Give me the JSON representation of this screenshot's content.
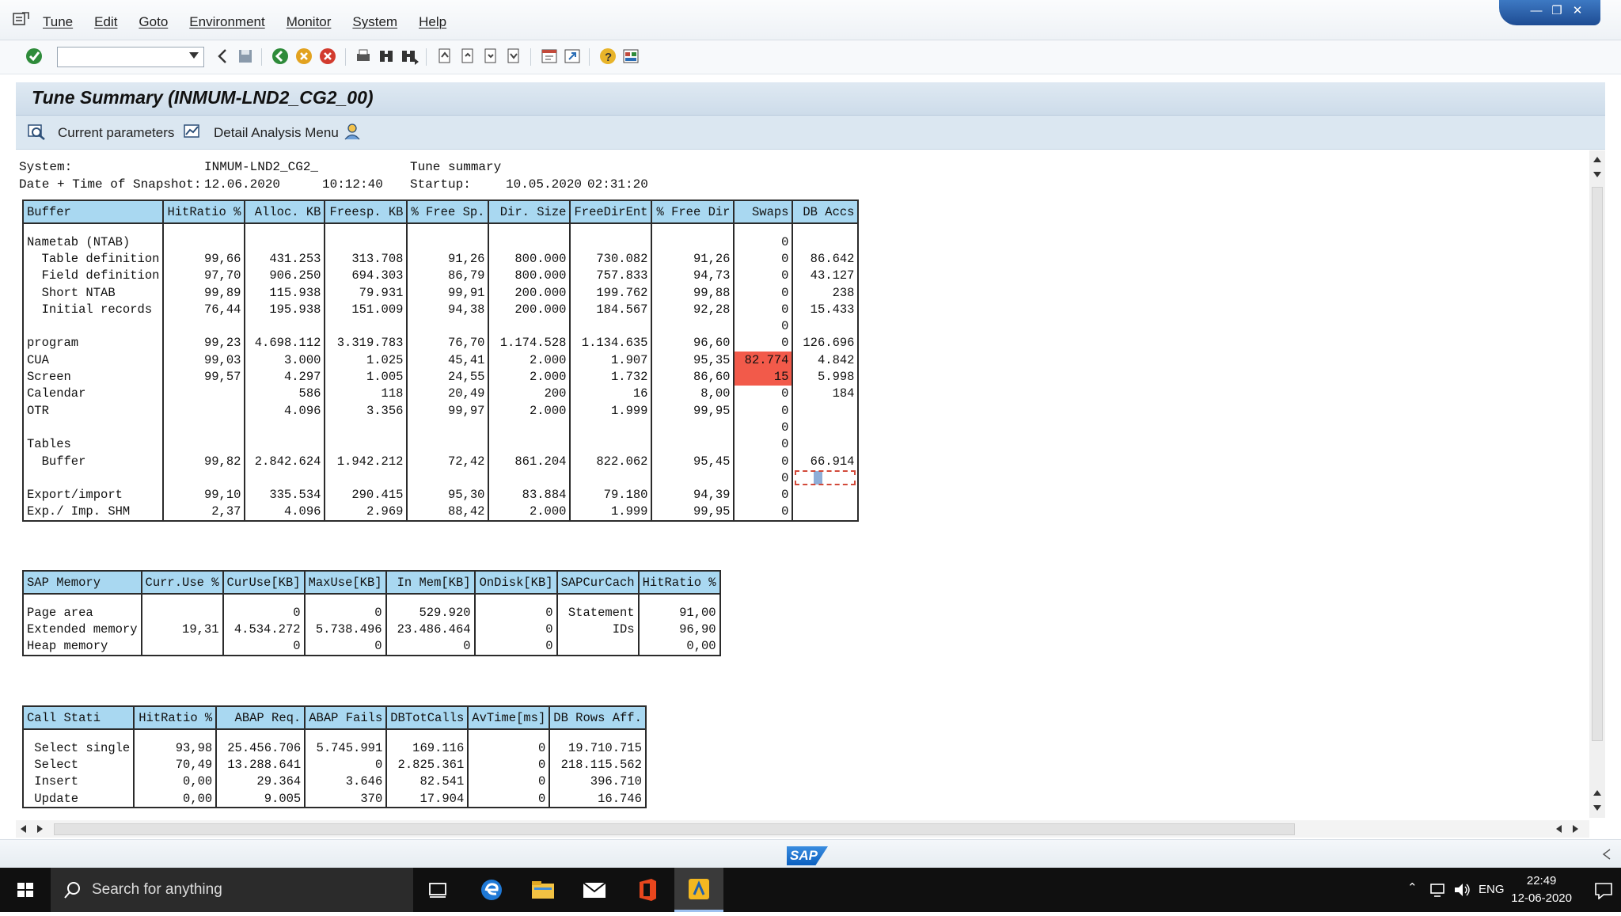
{
  "menu": [
    "Tune",
    "Edit",
    "Goto",
    "Environment",
    "Monitor",
    "System",
    "Help"
  ],
  "toolbar": {
    "command_value": ""
  },
  "page": {
    "title": "Tune Summary (INMUM-LND2_CG2_00)"
  },
  "app_toolbar": {
    "current_params": "Current parameters",
    "detail_menu": "Detail Analysis Menu"
  },
  "header": {
    "system_label": "System:",
    "system_value": "INMUM-LND2_CG2_",
    "summary_label": "Tune summary",
    "snapshot_label": "Date + Time of Snapshot:",
    "snapshot_date": "12.06.2020",
    "snapshot_time": "10:12:40",
    "startup_label": "Startup:",
    "startup_date": "10.05.2020",
    "startup_time": "02:31:20"
  },
  "buffer_table": {
    "columns": [
      "Buffer",
      "HitRatio %",
      "Alloc. KB",
      "Freesp. KB",
      "% Free Sp.",
      "Dir. Size",
      "FreeDirEnt",
      "% Free Dir",
      "Swaps",
      "DB Accs"
    ],
    "rows": [
      [
        "",
        "",
        "",
        "",
        "",
        "",
        "",
        "",
        "",
        ""
      ],
      [
        "Nametab (NTAB)",
        "",
        "",
        "",
        "",
        "",
        "",
        "",
        "0",
        ""
      ],
      [
        "  Table definition",
        "99,66",
        "431.253",
        "313.708",
        "91,26",
        "800.000",
        "730.082",
        "91,26",
        "0",
        "86.642"
      ],
      [
        "  Field definition",
        "97,70",
        "906.250",
        "694.303",
        "86,79",
        "800.000",
        "757.833",
        "94,73",
        "0",
        "43.127"
      ],
      [
        "  Short NTAB",
        "99,89",
        "115.938",
        "79.931",
        "99,91",
        "200.000",
        "199.762",
        "99,88",
        "0",
        "238"
      ],
      [
        "  Initial records",
        "76,44",
        "195.938",
        "151.009",
        "94,38",
        "200.000",
        "184.567",
        "92,28",
        "0",
        "15.433"
      ],
      [
        "",
        "",
        "",
        "",
        "",
        "",
        "",
        "",
        "0",
        ""
      ],
      [
        "program",
        "99,23",
        "4.698.112",
        "3.319.783",
        "76,70",
        "1.174.528",
        "1.134.635",
        "96,60",
        "0",
        "126.696"
      ],
      [
        "CUA",
        "99,03",
        "3.000",
        "1.025",
        "45,41",
        "2.000",
        "1.907",
        "95,35",
        "82.774",
        "4.842"
      ],
      [
        "Screen",
        "99,57",
        "4.297",
        "1.005",
        "24,55",
        "2.000",
        "1.732",
        "86,60",
        "15",
        "5.998"
      ],
      [
        "Calendar",
        "",
        "586",
        "118",
        "20,49",
        "200",
        "16",
        "8,00",
        "0",
        "184"
      ],
      [
        "OTR",
        "",
        "4.096",
        "3.356",
        "99,97",
        "2.000",
        "1.999",
        "99,95",
        "0",
        ""
      ],
      [
        "",
        "",
        "",
        "",
        "",
        "",
        "",
        "",
        "0",
        ""
      ],
      [
        "Tables",
        "",
        "",
        "",
        "",
        "",
        "",
        "",
        "0",
        ""
      ],
      [
        "  Buffer",
        "99,82",
        "2.842.624",
        "1.942.212",
        "72,42",
        "861.204",
        "822.062",
        "95,45",
        "0",
        "66.914"
      ],
      [
        "",
        "",
        "",
        "",
        "",
        "",
        "",
        "",
        "0",
        ""
      ],
      [
        "Export/import",
        "99,10",
        "335.534",
        "290.415",
        "95,30",
        "83.884",
        "79.180",
        "94,39",
        "0",
        ""
      ],
      [
        "Exp./ Imp. SHM",
        "2,37",
        "4.096",
        "2.969",
        "88,42",
        "2.000",
        "1.999",
        "99,95",
        "0",
        ""
      ]
    ],
    "highlight_color": "#f25a4a"
  },
  "memory_table": {
    "columns": [
      "SAP Memory",
      "Curr.Use %",
      "CurUse[KB]",
      "MaxUse[KB]",
      "In Mem[KB]",
      "OnDisk[KB]",
      "SAPCurCach",
      "HitRatio %"
    ],
    "rows": [
      [
        "",
        "",
        "",
        "",
        "",
        "",
        "",
        ""
      ],
      [
        "Page area",
        "",
        "0",
        "0",
        "529.920",
        "0",
        "Statement",
        "91,00"
      ],
      [
        "Extended memory",
        "19,31",
        "4.534.272",
        "5.738.496",
        "23.486.464",
        "0",
        "IDs",
        "96,90"
      ],
      [
        "Heap memory",
        "",
        "0",
        "0",
        "0",
        "0",
        "",
        "0,00"
      ]
    ]
  },
  "call_table": {
    "columns": [
      "Call Stati",
      "HitRatio %",
      "ABAP Req.",
      "ABAP Fails",
      "DBTotCalls",
      "AvTime[ms]",
      "DB Rows Aff."
    ],
    "rows": [
      [
        "",
        "",
        "",
        "",
        "",
        "",
        ""
      ],
      [
        " Select single",
        "93,98",
        "25.456.706",
        "5.745.991",
        "169.116",
        "0",
        "19.710.715"
      ],
      [
        " Select",
        "70,49",
        "13.288.641",
        "0",
        "2.825.361",
        "0",
        "218.115.562"
      ],
      [
        " Insert",
        "0,00",
        "29.364",
        "3.646",
        "82.541",
        "0",
        "396.710"
      ],
      [
        " Update",
        "0,00",
        "9.005",
        "370",
        "17.904",
        "0",
        "16.746"
      ]
    ]
  },
  "statusbar": {
    "logo": "SAP"
  },
  "taskbar": {
    "search_placeholder": "Search for anything",
    "language": "ENG",
    "time": "22:49",
    "date": "12-06-2020"
  }
}
